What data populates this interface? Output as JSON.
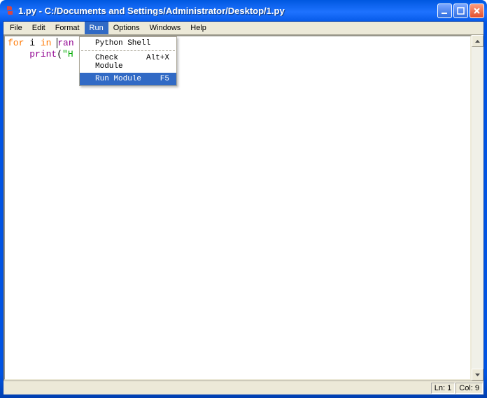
{
  "titlebar": {
    "text": "1.py - C:/Documents and Settings/Administrator/Desktop/1.py"
  },
  "menubar": {
    "items": [
      {
        "label": "File",
        "active": false
      },
      {
        "label": "Edit",
        "active": false
      },
      {
        "label": "Format",
        "active": false
      },
      {
        "label": "Run",
        "active": true
      },
      {
        "label": "Options",
        "active": false
      },
      {
        "label": "Windows",
        "active": false
      },
      {
        "label": "Help",
        "active": false
      }
    ]
  },
  "dropdown": {
    "items": [
      {
        "label": "Python Shell",
        "accel": "",
        "highlight": false
      },
      {
        "sep": true
      },
      {
        "label": "Check Module",
        "accel": "Alt+X",
        "highlight": false
      },
      {
        "label": "Run Module",
        "accel": "F5",
        "highlight": true
      }
    ]
  },
  "code": {
    "line1": {
      "kw1": "for",
      "var": " i ",
      "kw2": "in",
      "sp": " ",
      "fn": "ran"
    },
    "line2": {
      "indent": "    ",
      "fn": "print",
      "paren": "(",
      "str": "\"H"
    }
  },
  "status": {
    "ln_label": "Ln: ",
    "ln": "1",
    "col_label": "Col: ",
    "col": "9"
  }
}
